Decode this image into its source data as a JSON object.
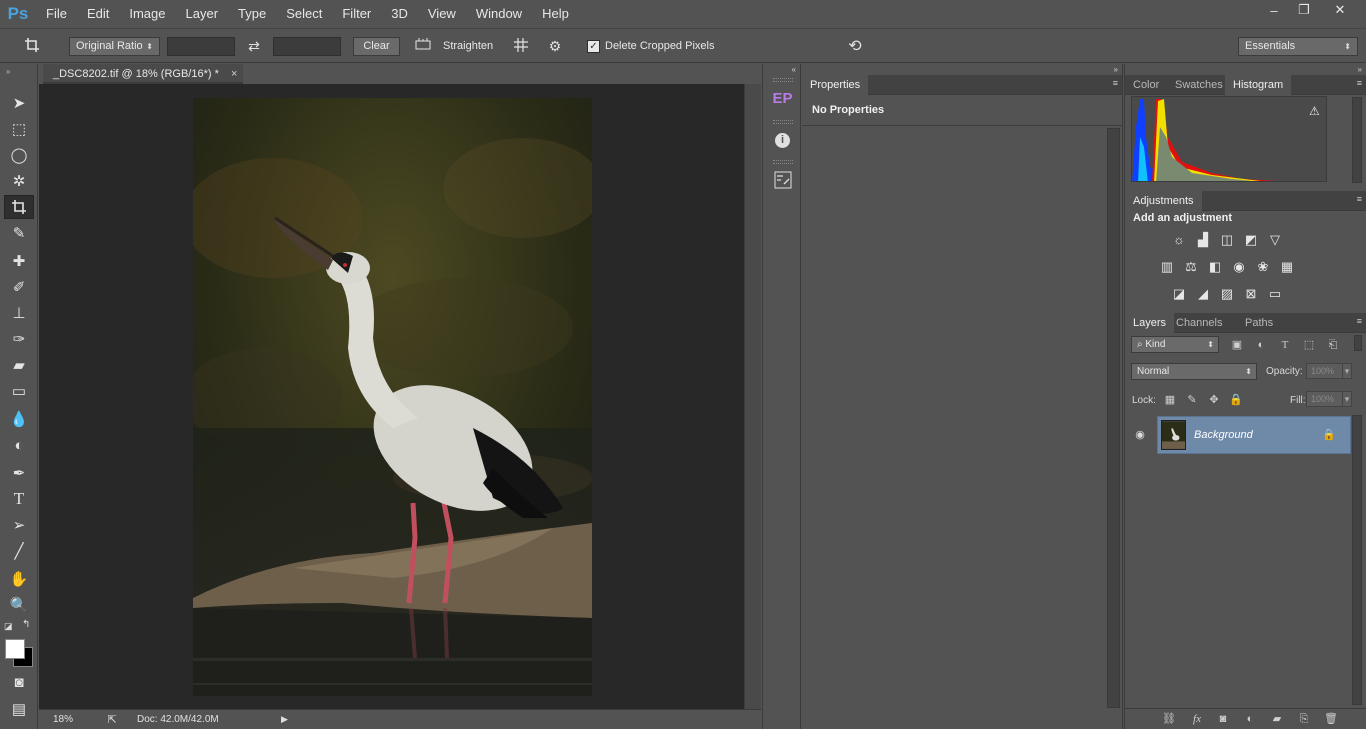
{
  "app": {
    "logo": "Ps",
    "menu": [
      "File",
      "Edit",
      "Image",
      "Layer",
      "Type",
      "Select",
      "Filter",
      "3D",
      "View",
      "Window",
      "Help"
    ],
    "window_controls": {
      "minimize": "–",
      "restore": "❐",
      "close": "✕"
    }
  },
  "options_bar": {
    "ratio_preset": "Original Ratio",
    "width_value": "",
    "height_value": "",
    "clear_label": "Clear",
    "straighten_label": "Straighten",
    "delete_cropped_label": "Delete Cropped Pixels",
    "delete_cropped_checked": true,
    "workspace": "Essentials",
    "icons": [
      "crop-tool-icon",
      "swap-icon",
      "straighten-icon",
      "overlay-grid-icon",
      "gear-icon",
      "reset-icon"
    ]
  },
  "document": {
    "tab_title": "_DSC8202.tif @ 18% (RGB/16*) *",
    "tab_close": "×",
    "zoom": "18%",
    "doc_size": "Doc: 42.0M/42.0M"
  },
  "tools": [
    "move",
    "marquee",
    "lasso",
    "quick-select",
    "crop",
    "eyedropper",
    "spot-heal",
    "brush",
    "clone-stamp",
    "history-brush",
    "eraser",
    "gradient",
    "blur",
    "dodge",
    "pen",
    "type",
    "path-select",
    "line",
    "hand",
    "zoom",
    "quick-mask",
    "screen-mode"
  ],
  "dock": {
    "ep_label": "EP",
    "info_glyph": "i"
  },
  "properties": {
    "tab_label": "Properties",
    "empty_message": "No Properties"
  },
  "color_panel": {
    "tabs": [
      "Color",
      "Swatches",
      "Histogram"
    ],
    "active_tab": "Histogram",
    "warning_glyph": "⚠"
  },
  "adjustments": {
    "tab_label": "Adjustments",
    "heading": "Add an adjustment",
    "row1": [
      "brightness-contrast",
      "levels",
      "curves",
      "exposure",
      "vibrance"
    ],
    "row2": [
      "hue-saturation",
      "color-balance",
      "black-white",
      "photo-filter",
      "channel-mixer",
      "color-lookup"
    ],
    "row3": [
      "invert",
      "posterize",
      "threshold",
      "selective-color",
      "gradient-map"
    ]
  },
  "layers": {
    "tabs": [
      "Layers",
      "Channels",
      "Paths"
    ],
    "active_tab": "Layers",
    "kind_filter": "Kind",
    "blend_mode": "Normal",
    "opacity_label": "Opacity:",
    "opacity_value": "100%",
    "lock_label": "Lock:",
    "fill_label": "Fill:",
    "fill_value": "100%",
    "items": [
      {
        "name": "Background",
        "visible": true,
        "locked": true,
        "selected": true
      }
    ],
    "footer": [
      "link-icon",
      "fx-icon",
      "mask-icon",
      "adjustment-layer-icon",
      "group-icon",
      "new-layer-icon",
      "trash-icon"
    ]
  },
  "colors": {
    "chrome": "#535353",
    "dark_panel": "#424242",
    "canvas_bg": "#282828",
    "selection": "#6f89a8",
    "ps_blue": "#4aa3df",
    "ep_purple": "#b77ce8"
  }
}
